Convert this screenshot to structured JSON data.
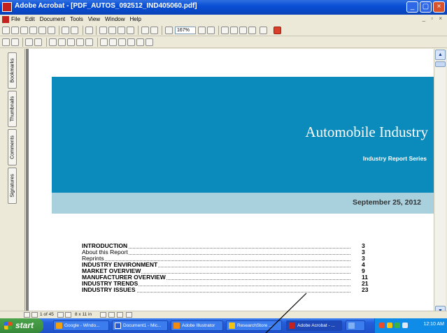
{
  "window": {
    "title": "Adobe Acrobat - [PDF_AUTOS_092512_IND405060.pdf]",
    "buttons": {
      "minimize": "_",
      "maximize": "▢",
      "close": "×"
    }
  },
  "menu": {
    "items": [
      "File",
      "Edit",
      "Document",
      "Tools",
      "View",
      "Window",
      "Help"
    ],
    "mdi_controls": "_ ▫ ×"
  },
  "toolbar": {
    "zoom_value": "167%"
  },
  "nav_tabs": [
    "Bookmarks",
    "Thumbnails",
    "Comments",
    "Signatures"
  ],
  "document": {
    "title": "Automobile Industry",
    "subtitle": "Industry Report Series",
    "date": "September 25, 2012",
    "toc": [
      {
        "label": "INTRODUCTION",
        "page": "3",
        "bold": true
      },
      {
        "label": "About this Report",
        "page": "3",
        "bold": false
      },
      {
        "label": "Reprints",
        "page": "3",
        "bold": false
      },
      {
        "label": "INDUSTRY ENVIRONMENT",
        "page": "4",
        "bold": true
      },
      {
        "label": "MARKET OVERVIEW",
        "page": "9",
        "bold": true
      },
      {
        "label": "MANUFACTURER OVERVIEW",
        "page": "11",
        "bold": true
      },
      {
        "label": "INDUSTRY TRENDS",
        "page": "21",
        "bold": true
      },
      {
        "label": "INDUSTRY ISSUES",
        "page": "23",
        "bold": true
      }
    ]
  },
  "page_nav": {
    "page_indicator": "1 of 45",
    "page_size": "8 x 11 in"
  },
  "taskbar": {
    "start_label": "start",
    "tasks": [
      {
        "label": "Google - Windo...",
        "color": "#f2a010"
      },
      {
        "label": "Document1 - Mic...",
        "color": "#2a5bd6"
      },
      {
        "label": "Adobe Illustrator",
        "color": "#f08a10"
      },
      {
        "label": "ResearchStore ...",
        "color": "#f2c40f"
      },
      {
        "label": "Adobe Acrobat - ...",
        "color": "#c4221c"
      }
    ],
    "clock": "12:10 AM"
  },
  "colors": {
    "banner": "#0b8bbb",
    "date_band": "#a8d0dd",
    "titlebar": "#0a4fd6",
    "taskbar": "#245edb"
  }
}
